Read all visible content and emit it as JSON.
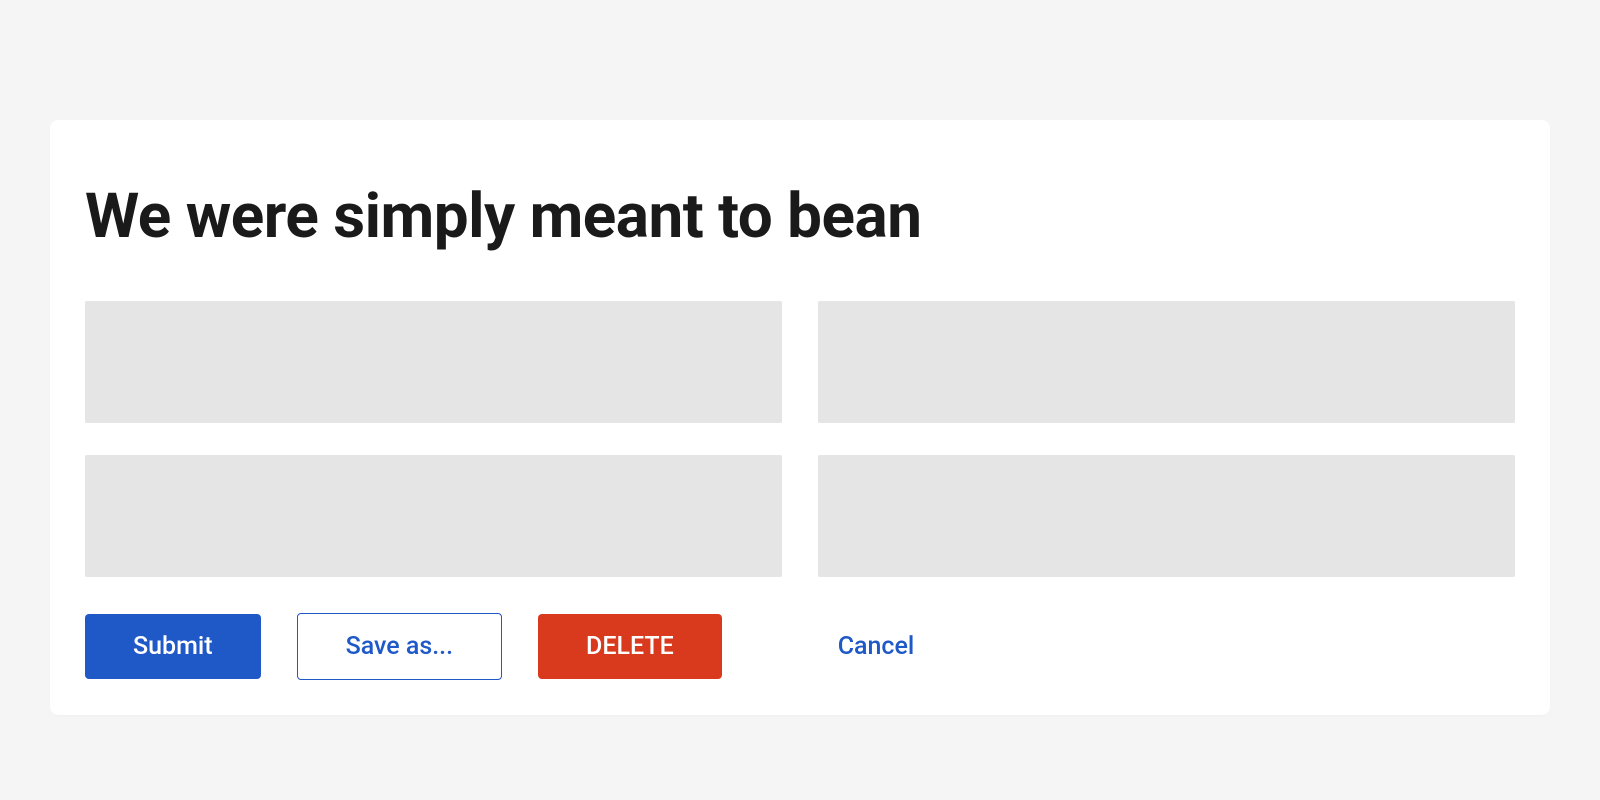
{
  "card": {
    "title": "We were simply meant to bean"
  },
  "buttons": {
    "submit": "Submit",
    "save_as": "Save as...",
    "delete": "DELETE",
    "cancel": "Cancel"
  },
  "colors": {
    "primary": "#1f58c7",
    "danger": "#d93a1e",
    "field_bg": "#e5e5e5",
    "page_bg": "#f5f5f5",
    "card_bg": "#ffffff"
  }
}
